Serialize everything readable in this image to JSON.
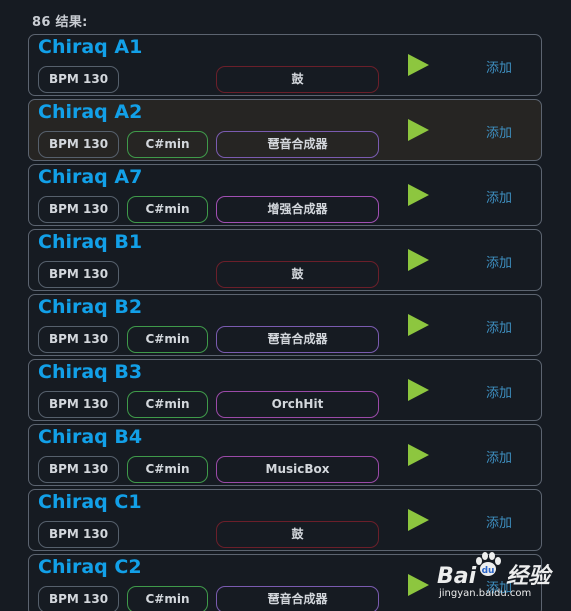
{
  "results": {
    "count_label": "86 结果:",
    "add_label": "添加",
    "items": [
      {
        "name": "Chiraq A1",
        "bpm": "BPM 130",
        "key": "",
        "instrument": "鼓",
        "instrument_color": "#6b1f2a"
      },
      {
        "name": "Chiraq A2",
        "bpm": "BPM 130",
        "key": "C#min",
        "instrument": "琶音合成器",
        "instrument_color": "#7a5bb0",
        "selected": true
      },
      {
        "name": "Chiraq A7",
        "bpm": "BPM 130",
        "key": "C#min",
        "instrument": "增强合成器",
        "instrument_color": "#a14fb3"
      },
      {
        "name": "Chiraq B1",
        "bpm": "BPM 130",
        "key": "",
        "instrument": "鼓",
        "instrument_color": "#6b1f2a"
      },
      {
        "name": "Chiraq B2",
        "bpm": "BPM 130",
        "key": "C#min",
        "instrument": "琶音合成器",
        "instrument_color": "#7a5bb0"
      },
      {
        "name": "Chiraq B3",
        "bpm": "BPM 130",
        "key": "C#min",
        "instrument": "OrchHit",
        "instrument_color": "#9b4aa8"
      },
      {
        "name": "Chiraq B4",
        "bpm": "BPM 130",
        "key": "C#min",
        "instrument": "MusicBox",
        "instrument_color": "#9b4aa8"
      },
      {
        "name": "Chiraq C1",
        "bpm": "BPM 130",
        "key": "",
        "instrument": "鼓",
        "instrument_color": "#6b1f2a"
      },
      {
        "name": "Chiraq C2",
        "bpm": "BPM 130",
        "key": "C#min",
        "instrument": "琶音合成器",
        "instrument_color": "#7a5bb0"
      }
    ]
  },
  "colors": {
    "title": "#12a0e8",
    "play": "#8dc63f",
    "add": "#3e8fc0",
    "key_border": "#3f9a4a",
    "card_border": "#5c6470"
  },
  "icons": {
    "play": "play-icon"
  },
  "watermark": {
    "logo": "Bai 经验",
    "site": "jingyan.baidu.com"
  }
}
